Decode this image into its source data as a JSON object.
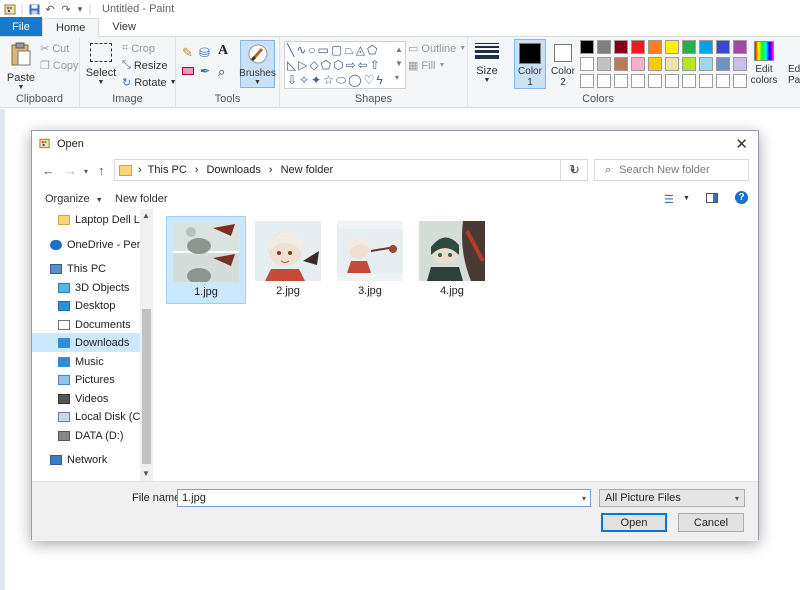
{
  "app": {
    "title": "Untitled - Paint"
  },
  "ribbon_tabs": [
    {
      "label": "File"
    },
    {
      "label": "Home"
    },
    {
      "label": "View"
    }
  ],
  "clipboard": {
    "paste": "Paste",
    "cut": "Cut",
    "copy": "Copy",
    "label": "Clipboard"
  },
  "image": {
    "select": "Select",
    "crop": "Crop",
    "resize": "Resize",
    "rotate": "Rotate",
    "label": "Image"
  },
  "tools": {
    "label": "Tools",
    "brushes": "Brushes"
  },
  "shapes": {
    "outline": "Outline",
    "fill": "Fill",
    "label": "Shapes"
  },
  "size": {
    "label": "Size"
  },
  "colors": {
    "color1": "Color 1",
    "color2": "Color 2",
    "label": "Colors",
    "edit": "Edit colors",
    "edit_paint": "Edit Pa",
    "row1": [
      "#000000",
      "#7f7f7f",
      "#880015",
      "#ed1c24",
      "#ff7f27",
      "#fff200",
      "#22b14c",
      "#00a2e8",
      "#3f48cc",
      "#a349a4"
    ],
    "row2": [
      "#ffffff",
      "#c3c3c3",
      "#b97a57",
      "#ffaec9",
      "#ffc90e",
      "#efe4b0",
      "#b5e61d",
      "#99d9ea",
      "#7092be",
      "#c8bfe7"
    ]
  },
  "dialog": {
    "title": "Open",
    "breadcrumb": [
      "This PC",
      "Downloads",
      "New folder"
    ],
    "search_placeholder": "Search New folder",
    "organize": "Organize",
    "new_folder": "New folder",
    "nav_items": [
      {
        "label": "Laptop Dell Latit"
      },
      {
        "label": "OneDrive - Person"
      },
      {
        "label": "This PC"
      },
      {
        "label": "3D Objects"
      },
      {
        "label": "Desktop"
      },
      {
        "label": "Documents"
      },
      {
        "label": "Downloads"
      },
      {
        "label": "Music"
      },
      {
        "label": "Pictures"
      },
      {
        "label": "Videos"
      },
      {
        "label": "Local Disk (C:)"
      },
      {
        "label": "DATA (D:)"
      },
      {
        "label": "Network"
      }
    ],
    "files": [
      {
        "name": "1.jpg"
      },
      {
        "name": "2.jpg"
      },
      {
        "name": "3.jpg"
      },
      {
        "name": "4.jpg"
      }
    ],
    "file_name_label": "File name:",
    "file_name_value": "1.jpg",
    "file_type": "All Picture Files",
    "open": "Open",
    "cancel": "Cancel"
  }
}
